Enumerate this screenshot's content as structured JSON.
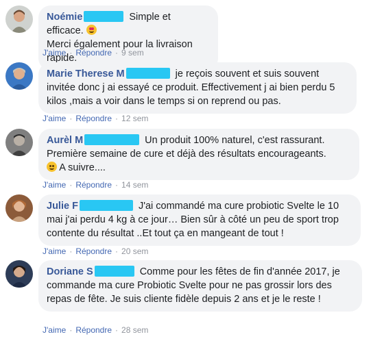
{
  "comments": [
    {
      "author": "Noémie",
      "text": "Simple et efficace.",
      "text_line2": "Merci également pour la livraison rapide.",
      "emoji": "heart-eyes-emoji",
      "like": "J'aime",
      "reply": "Répondre",
      "time": "9 sem"
    },
    {
      "author": "Marie Therese M",
      "text": "je reçois souvent et suis souvent invitée donc j ai essayé ce produit. Effectivement j ai bien perdu 5 kilos ,mais a voir dans le temps si on reprend ou pas.",
      "like": "J'aime",
      "reply": "Répondre",
      "time": "12 sem"
    },
    {
      "author": "Aurèl M",
      "text": "Un produit 100% naturel, c'est rassurant. Première semaine de cure et déjà des résultats encourageants.",
      "text_tail": "A suivre....",
      "emoji": "smile-emoji",
      "like": "J'aime",
      "reply": "Répondre",
      "time": "14 sem"
    },
    {
      "author": "Julie F",
      "text": "J'ai commandé ma cure probiotic Svelte le 10 mai j'ai perdu 4 kg à ce jour… Bien sûr à côté un peu de sport trop contente du résultat ..Et tout ça en mangeant de tout !",
      "like": "J'aime",
      "reply": "Répondre",
      "time": "20 sem"
    },
    {
      "author": "Doriane S",
      "text": "Comme pour les fêtes de fin d'année 2017, je commande ma cure Probiotic Svelte pour ne pas grossir lors des repas de fête. Je suis cliente fidèle depuis 2 ans et je le reste !",
      "like": "J'aime",
      "reply": "Répondre",
      "time": "28 sem"
    }
  ],
  "colors": {
    "author": "#385898",
    "link": "#4267b2",
    "bubble": "#f2f3f5",
    "redaction": "#29c7f3",
    "meta": "#90949c"
  }
}
